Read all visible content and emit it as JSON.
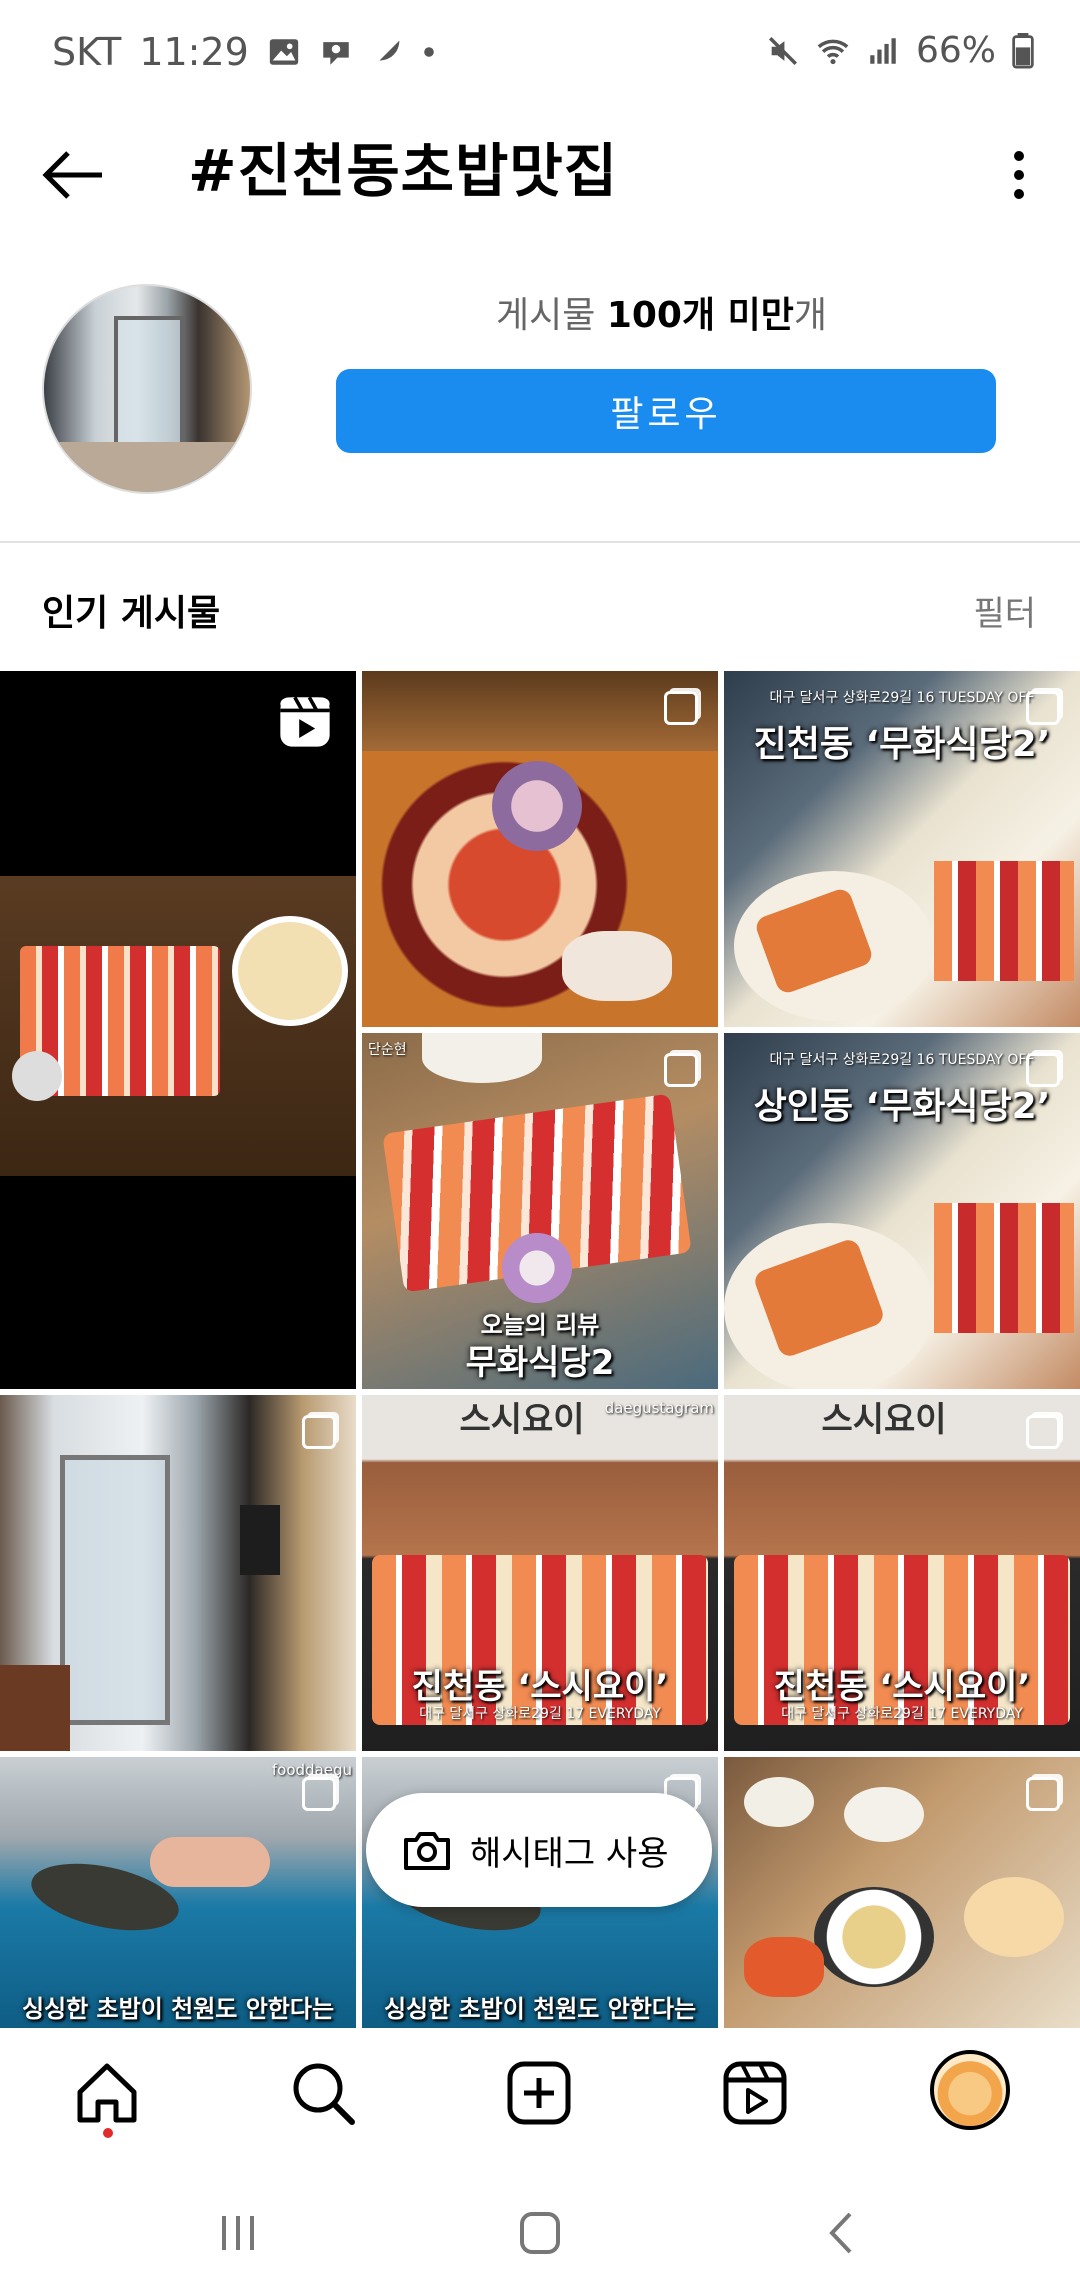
{
  "status_bar": {
    "carrier": "SKT",
    "time": "11:29",
    "battery": "66%"
  },
  "header": {
    "title": "#진천동초밥맛집"
  },
  "profile": {
    "post_count_label": "게시물",
    "post_count_value": "100개 미만",
    "post_count_suffix": "개",
    "follow_label": "팔로우"
  },
  "section": {
    "title": "인기 게시물",
    "filter_label": "필터"
  },
  "grid": {
    "tiles": [
      {
        "type": "reel"
      },
      {
        "type": "carousel"
      },
      {
        "type": "carousel",
        "top_small": "대구 달서구 상화로29길 16 TUESDAY OFF",
        "headline": "진천동 ‘무화식당2’"
      },
      {
        "type": "carousel",
        "top_small": "단순현",
        "caption_top": "오늘의 리뷰",
        "caption_bottom": "무화식당2"
      },
      {
        "type": "carousel",
        "top_small": "대구 달서구 상화로29길 16 TUESDAY OFF",
        "headline": "상인동 ‘무화식당2’"
      },
      {
        "type": "carousel"
      },
      {
        "type": "carousel",
        "sign": "스시요이",
        "handle": "daegustagram",
        "headline": "진천동 ‘스시요이’",
        "bottom_small": "대구 달서구 상화로29길 17 EVERYDAY"
      },
      {
        "type": "carousel",
        "sign": "스시요이",
        "headline": "진천동 ‘스시요이’",
        "bottom_small": "대구 달서구 상화로29길 17 EVERYDAY"
      },
      {
        "type": "carousel",
        "handle": "fooddaegu",
        "bottom_caption": "싱싱한 초밥이 천원도 안한다는"
      },
      {
        "type": "carousel",
        "bottom_caption": "싱싱한 초밥이 천원도 안한다는"
      },
      {
        "type": "carousel"
      }
    ],
    "use_hashtag_label": "해시태그 사용"
  },
  "colors": {
    "follow_button": "#1a8cf0",
    "notification_dot": "#e02b2b"
  },
  "icons": {
    "back": "arrow-left-icon",
    "more": "more-vertical-icon",
    "reel": "reel-icon",
    "multi": "carousel-icon",
    "camera": "camera-icon",
    "home": "home-icon",
    "search": "search-icon",
    "create": "plus-square-icon",
    "reels": "reels-icon"
  }
}
